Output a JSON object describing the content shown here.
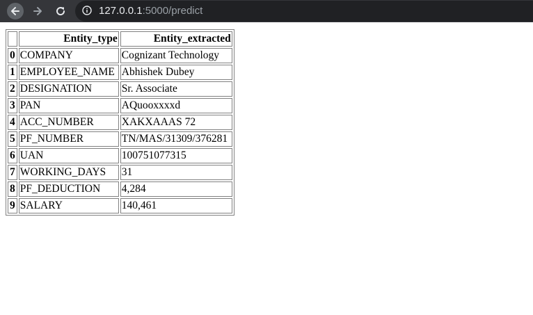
{
  "browser": {
    "url_host": "127.0.0.1",
    "url_rest": ":5000/predict"
  },
  "table": {
    "columns": [
      "",
      "Entity_type",
      "Entity_extracted"
    ],
    "rows": [
      {
        "index": "0",
        "entity_type": "COMPANY",
        "entity_extracted": "Cognizant Technology"
      },
      {
        "index": "1",
        "entity_type": "EMPLOYEE_NAME",
        "entity_extracted": "Abhishek Dubey"
      },
      {
        "index": "2",
        "entity_type": "DESIGNATION",
        "entity_extracted": "Sr. Associate"
      },
      {
        "index": "3",
        "entity_type": "PAN",
        "entity_extracted": "AQuooxxxxd"
      },
      {
        "index": "4",
        "entity_type": "ACC_NUMBER",
        "entity_extracted": "XAKXAAAS 72"
      },
      {
        "index": "5",
        "entity_type": "PF_NUMBER",
        "entity_extracted": "TN/MAS/31309/376281"
      },
      {
        "index": "6",
        "entity_type": "UAN",
        "entity_extracted": "100751077315"
      },
      {
        "index": "7",
        "entity_type": "WORKING_DAYS",
        "entity_extracted": "31"
      },
      {
        "index": "8",
        "entity_type": "PF_DEDUCTION",
        "entity_extracted": "4,284"
      },
      {
        "index": "9",
        "entity_type": "SALARY",
        "entity_extracted": "140,461"
      }
    ]
  },
  "icons": {
    "back": "arrow-left-icon",
    "forward": "arrow-right-icon",
    "reload": "reload-icon",
    "info": "info-icon"
  }
}
